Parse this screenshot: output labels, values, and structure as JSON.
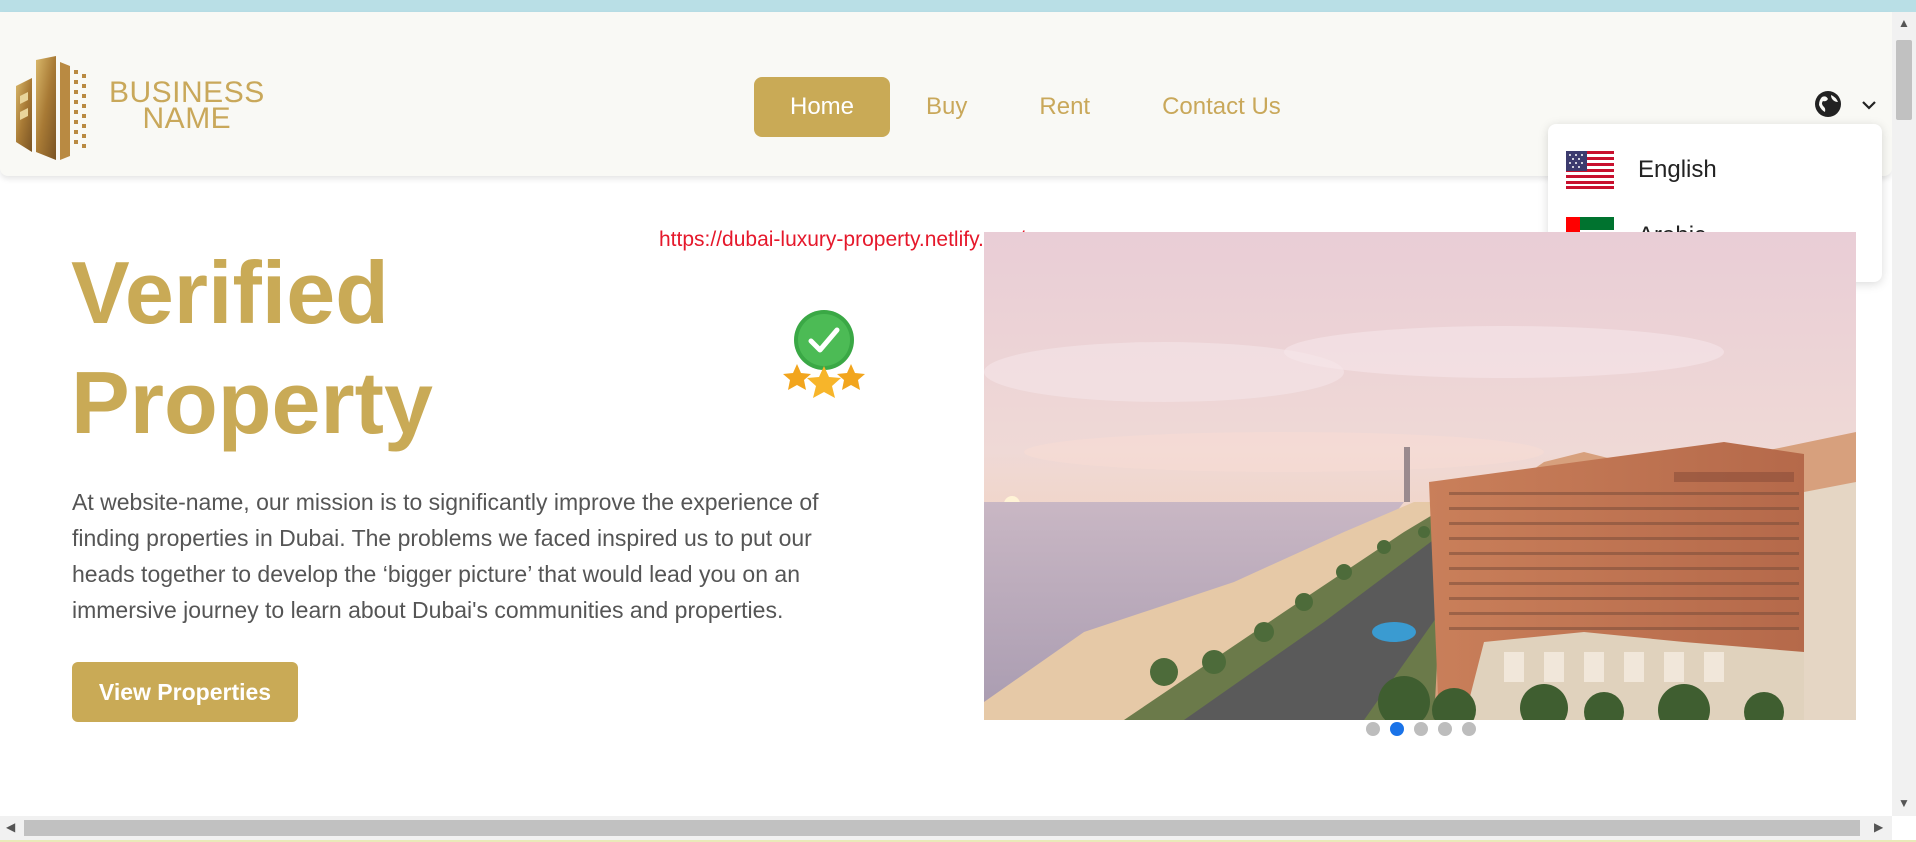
{
  "logo": {
    "line1": "BUSINESS",
    "line2": "NAME"
  },
  "nav": {
    "items": [
      {
        "label": "Home",
        "active": true
      },
      {
        "label": "Buy",
        "active": false
      },
      {
        "label": "Rent",
        "active": false
      },
      {
        "label": "Contact Us",
        "active": false
      }
    ]
  },
  "language_menu": {
    "icon": "globe-icon",
    "options": [
      {
        "label": "English",
        "flag": "us-flag-icon"
      },
      {
        "label": "Arabic",
        "flag": "uae-flag-icon"
      }
    ]
  },
  "url_overlay": "https://dubai-luxury-property.netlify.app/",
  "hero": {
    "title_line1": "Verified",
    "title_line2": "Property",
    "description": "At website-name, our mission is to significantly improve the experience of finding properties in Dubai. The problems we faced inspired us to put our heads together to develop the ‘bigger picture’ that would lead you on an immersive journey to learn about Dubai's communities and properties.",
    "cta_label": "View Properties"
  },
  "carousel": {
    "slide_count": 5,
    "active_index": 1
  },
  "colors": {
    "brand_gold": "#c9aa56",
    "url_red": "#e5182b",
    "active_dot": "#1a73e8"
  }
}
